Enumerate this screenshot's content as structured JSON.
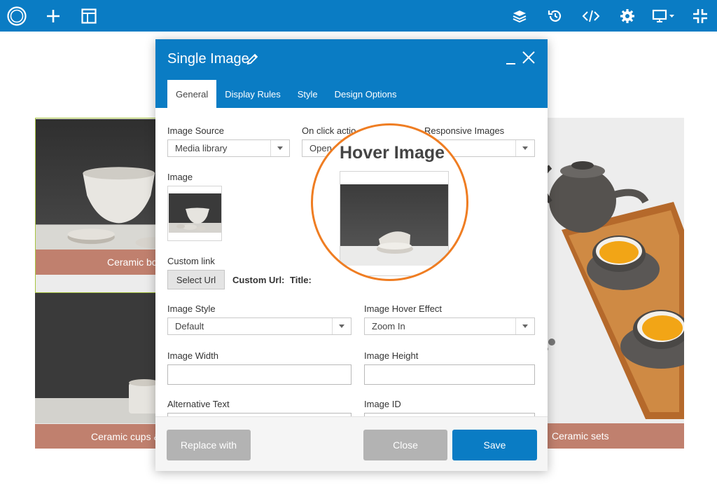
{
  "toolbar": {
    "icons": [
      "logo-icon",
      "add-icon",
      "layout-icon",
      "layers-icon",
      "history-icon",
      "code-icon",
      "settings-icon",
      "desktop-icon",
      "collapse-icon"
    ]
  },
  "gallery": {
    "cards": [
      {
        "caption": "Ceramic bo"
      },
      {
        "caption": "Ceramic cups &"
      },
      {
        "caption": "Ceramic sets"
      }
    ]
  },
  "modal": {
    "title": "Single Image",
    "tabs": [
      {
        "label": "General",
        "active": true
      },
      {
        "label": "Display Rules",
        "active": false
      },
      {
        "label": "Style",
        "active": false
      },
      {
        "label": "Design Options",
        "active": false
      }
    ],
    "fields": {
      "image_source_label": "Image Source",
      "image_source_value": "Media library",
      "on_click_label": "On click actio",
      "on_click_value": "Open",
      "responsive_label": "Responsive Images",
      "responsive_value": "e",
      "image_label": "Image",
      "custom_link_label": "Custom link",
      "select_url_label": "Select Url",
      "custom_url_label": "Custom Url:",
      "title_label": "Title:",
      "image_style_label": "Image Style",
      "image_style_value": "Default",
      "hover_effect_label": "Image Hover Effect",
      "hover_effect_value": "Zoom In",
      "image_width_label": "Image Width",
      "image_height_label": "Image Height",
      "alt_text_label": "Alternative Text",
      "image_id_label": "Image ID"
    },
    "footer": {
      "replace_label": "Replace with",
      "close_label": "Close",
      "save_label": "Save"
    }
  },
  "magnifier": {
    "title": "Hover Image"
  },
  "colors": {
    "brand_blue": "#0a7cc4",
    "caption_terracotta": "#c0806e",
    "callout_orange": "#ef7d22",
    "footer_gray": "#b3b3b3"
  }
}
